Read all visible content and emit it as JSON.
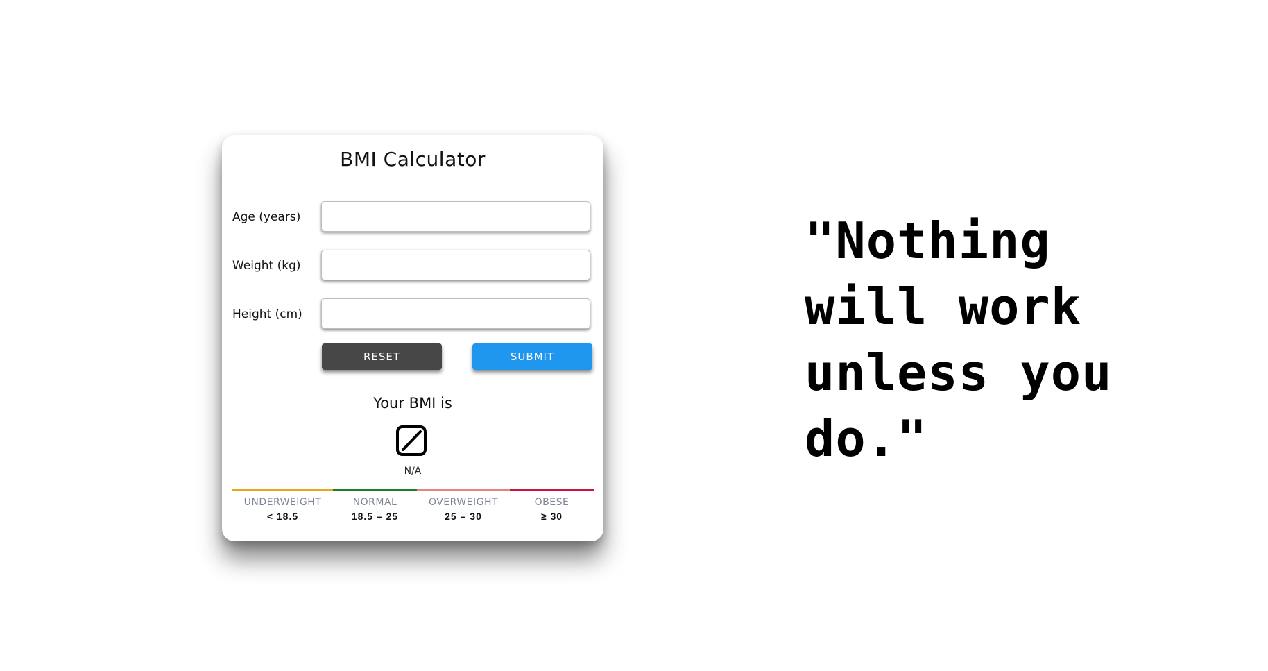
{
  "calculator": {
    "title": "BMI Calculator",
    "fields": {
      "age": {
        "label": "Age (years)",
        "value": "",
        "placeholder": ""
      },
      "weight": {
        "label": "Weight (kg)",
        "value": "",
        "placeholder": ""
      },
      "height": {
        "label": "Height (cm)",
        "value": "",
        "placeholder": ""
      }
    },
    "buttons": {
      "reset_label": "RESET",
      "submit_label": "SUBMIT"
    },
    "result": {
      "label": "Your BMI is",
      "icon": "empty-set-icon",
      "value": "N/A"
    },
    "scale": [
      {
        "name": "UNDERWEIGHT",
        "range": "< 18.5",
        "color": "#e8a317"
      },
      {
        "name": "NORMAL",
        "range": "18.5 – 25",
        "color": "#1a7f2a"
      },
      {
        "name": "OVERWEIGHT",
        "range": "25 – 30",
        "color": "#e8847f"
      },
      {
        "name": "OBESE",
        "range": "≥ 30",
        "color": "#c8153f"
      }
    ]
  },
  "quote": {
    "text": "\"Nothing will work unless you do.\""
  },
  "colors": {
    "reset_button": "#474747",
    "submit_button": "#1f97ef"
  }
}
